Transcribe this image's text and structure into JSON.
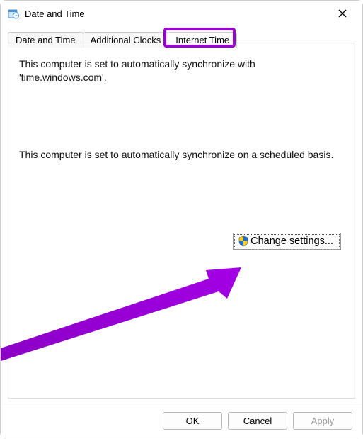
{
  "window": {
    "title": "Date and Time",
    "icon_name": "date-time-icon"
  },
  "tabs": [
    {
      "label": "Date and Time",
      "active": false
    },
    {
      "label": "Additional Clocks",
      "active": false
    },
    {
      "label": "Internet Time",
      "active": true
    }
  ],
  "content": {
    "sync_server_text": "This computer is set to automatically synchronize with 'time.windows.com'.",
    "sync_schedule_text": "This computer is set to automatically synchronize on a scheduled basis.",
    "change_settings_label": "Change settings..."
  },
  "footer": {
    "ok_label": "OK",
    "cancel_label": "Cancel",
    "apply_label": "Apply"
  },
  "annotation": {
    "highlight_tab_index": 2
  }
}
